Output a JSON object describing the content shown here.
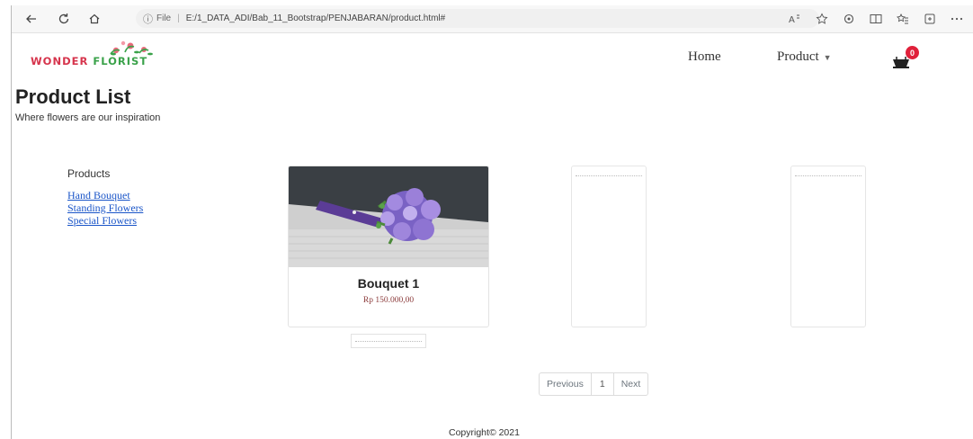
{
  "browser": {
    "address_prefix": "File",
    "url": "E:/1_DATA_ADI/Bab_11_Bootstrap/PENJABARAN/product.html#"
  },
  "brand": {
    "logo_word1": "WONDER",
    "logo_word2": "FLORIST",
    "color_primary": "#d6344c",
    "color_secondary": "#3aa24a"
  },
  "nav": {
    "home": "Home",
    "product": "Product",
    "cart_count": "0"
  },
  "header": {
    "title": "Product List",
    "subtitle": "Where flowers are our inspiration"
  },
  "sidebar": {
    "title": "Products",
    "links": [
      "Hand Bouquet",
      "Standing Flowers",
      "Special Flowers"
    ]
  },
  "products": [
    {
      "name": "Bouquet 1",
      "price": "Rp 150.000,00"
    }
  ],
  "pagination": {
    "previous": "Previous",
    "page": "1",
    "next": "Next"
  },
  "footer": {
    "copyright": "Copyright© 2021"
  }
}
